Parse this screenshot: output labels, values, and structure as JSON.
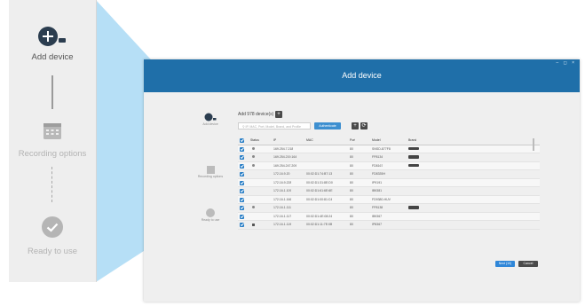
{
  "steps": [
    {
      "label": "Add device",
      "icon": "add-device-icon",
      "active": true
    },
    {
      "label": "Recording options",
      "icon": "calendar-icon",
      "active": false
    },
    {
      "label": "Ready to use",
      "icon": "checkmark-icon",
      "active": false
    }
  ],
  "window": {
    "title": "Add device",
    "controls": "– ◻ ×"
  },
  "toolbar": {
    "add_label": "Add 978 device(s)",
    "filter_placeholder": "IP, MAC, Port, Model, Brand, and Profile",
    "auth_button": "Authenticate"
  },
  "table": {
    "headers": [
      "Status",
      "IP",
      "MAC",
      "Port",
      "Model",
      "Brand"
    ],
    "rows": [
      {
        "ip": "169.254.7.218",
        "mac": "",
        "port": "80",
        "model": "SNSD-877F8",
        "brand": true,
        "status": "dot"
      },
      {
        "ip": "169.254.219.164",
        "mac": "",
        "port": "80",
        "model": "FP8134",
        "brand": true,
        "status": "dot"
      },
      {
        "ip": "169.254.247.209",
        "mac": "",
        "port": "80",
        "model": "FD8167",
        "brand": true,
        "status": "dot"
      },
      {
        "ip": "172.16.9.20",
        "mac": "00:02:D1:74:B7:13",
        "port": "80",
        "model": "FD8335H",
        "brand": false,
        "status": ""
      },
      {
        "ip": "172.16.9.228",
        "mac": "00:02:D1:31:8E:D0",
        "port": "80",
        "model": "IP9191",
        "brand": false,
        "status": ""
      },
      {
        "ip": "172.16.1.109",
        "mac": "00:02:D1:61:6E:6E",
        "port": "80",
        "model": "IB9381",
        "brand": false,
        "status": ""
      },
      {
        "ip": "172.16.1.166",
        "mac": "00:02:D1:00:81:C4",
        "port": "80",
        "model": "FD9380-HUV",
        "brand": false,
        "status": ""
      },
      {
        "ip": "172.16.1.111",
        "mac": "",
        "port": "80",
        "model": "FP8138",
        "brand": true,
        "status": "dot"
      },
      {
        "ip": "172.16.1.117",
        "mac": "00:02:D1:4E:08:24",
        "port": "80",
        "model": "IB9367",
        "brand": false,
        "status": ""
      },
      {
        "ip": "172.16.1.119",
        "mac": "00:02:D1:11:7E:0B",
        "port": "80",
        "model": "IP8367",
        "brand": false,
        "status": "lock"
      }
    ]
  },
  "footer": {
    "next_button": "Next (10)",
    "cancel_button": "Cancel"
  },
  "colors": {
    "accent": "#1f6fa9",
    "button_blue": "#2f86d8",
    "wedge": "#9fd3f3"
  }
}
